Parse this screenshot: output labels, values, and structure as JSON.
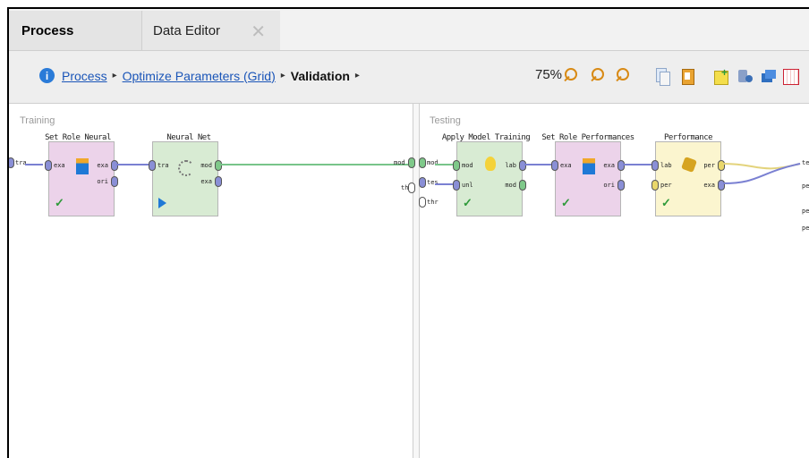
{
  "tabs": {
    "process": "Process",
    "data_editor": "Data Editor",
    "close_glyph": "✕"
  },
  "breadcrumb": {
    "info_glyph": "i",
    "items": [
      "Process",
      "Optimize Parameters (Grid)",
      "Validation"
    ],
    "separator": "▸"
  },
  "toolbar": {
    "zoom": "75%",
    "icons": [
      "zoom-fit-icon",
      "zoom-in-icon",
      "zoom-out-icon",
      "copy-icon",
      "clipboard-icon",
      "add-note-icon",
      "cut-icon",
      "stack-icon",
      "grid-icon"
    ]
  },
  "training": {
    "label": "Training",
    "input_port": "tra",
    "output_port": "mod",
    "operators": [
      {
        "title": "Set Role Neural",
        "in": [
          "exa"
        ],
        "out": [
          "exa",
          "ori"
        ],
        "status": "check"
      },
      {
        "title": "Neural Net",
        "in": [
          "tra"
        ],
        "out": [
          "mod",
          "exa"
        ],
        "status": "play"
      }
    ]
  },
  "testing": {
    "label": "Testing",
    "input_ports": [
      "mod",
      "tes",
      "thr"
    ],
    "output_ports": [
      "tes",
      "per",
      "per",
      "per"
    ],
    "operators": [
      {
        "title": "Apply Model Training",
        "in": [
          "mod",
          "unl"
        ],
        "out": [
          "lab",
          "mod"
        ],
        "status": "check"
      },
      {
        "title": "Set Role Performances",
        "in": [
          "exa"
        ],
        "out": [
          "exa",
          "ori"
        ],
        "status": "check"
      },
      {
        "title": "Performance",
        "in": [
          "lab",
          "per"
        ],
        "out": [
          "per",
          "exa"
        ],
        "status": "check"
      }
    ]
  },
  "colors": {
    "pink": "#ecd3ea",
    "green": "#d8ebd3",
    "yellow": "#fbf5cf",
    "link": "#1a55b8",
    "wire_blue": "#7a80d2",
    "wire_green": "#78c48a"
  }
}
